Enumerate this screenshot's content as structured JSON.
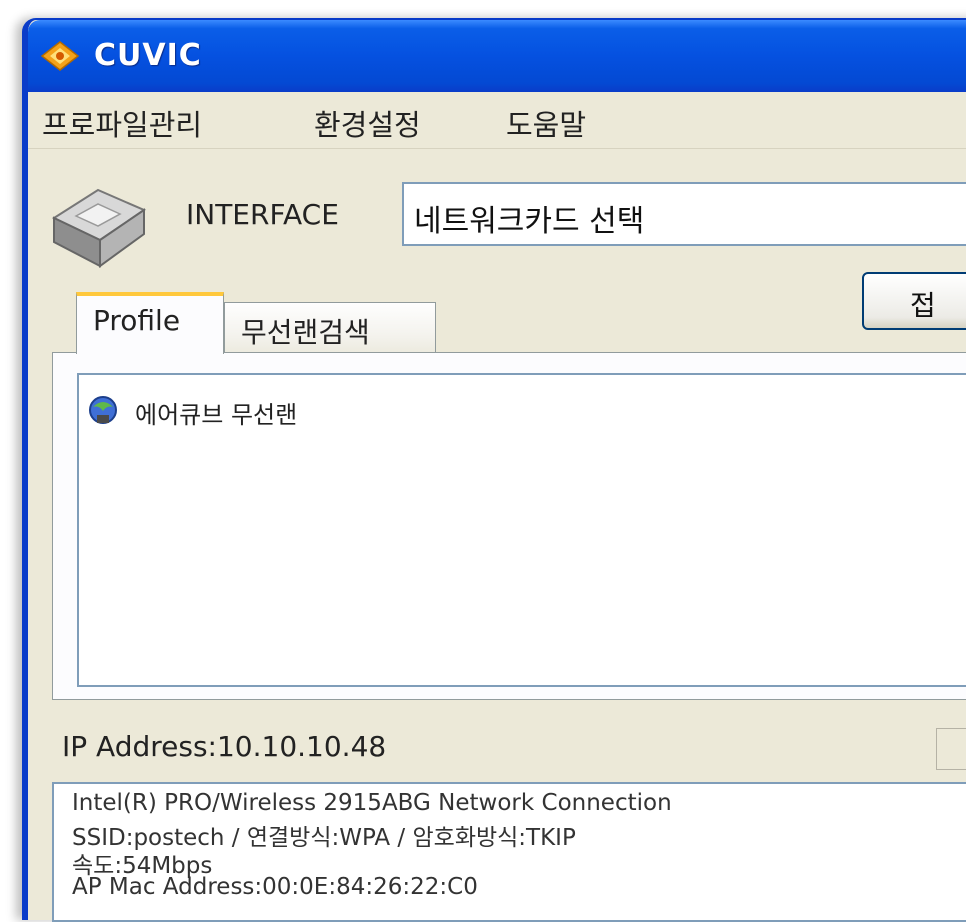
{
  "window": {
    "title": "CUVIC",
    "colors": {
      "titlebar": "#0551e0",
      "face": "#ece9d8",
      "tab_accent": "#ffc83c",
      "border": "#7f9db9"
    }
  },
  "menu": {
    "items": [
      "프로파일관리",
      "환경설정",
      "도움말"
    ]
  },
  "interface": {
    "label": "INTERFACE",
    "selected": "네트워크카드 선택",
    "icon": "network-card-icon"
  },
  "connect_button": {
    "label": "접"
  },
  "tabs": [
    {
      "label": "Profile",
      "active": true
    },
    {
      "label": "무선랜검색",
      "active": false
    }
  ],
  "profiles": [
    {
      "name": "에어큐브 무선랜",
      "icon": "wireless-profile-icon"
    }
  ],
  "status": {
    "ip_address": "IP Address:10.10.10.48",
    "info_lines": [
      "Intel(R) PRO/Wireless 2915ABG Network Connection",
      "SSID:postech / 연결방식:WPA / 암호화방식:TKIP",
      "속도:54Mbps",
      "AP Mac Address:00:0E:84:26:22:C0"
    ]
  }
}
